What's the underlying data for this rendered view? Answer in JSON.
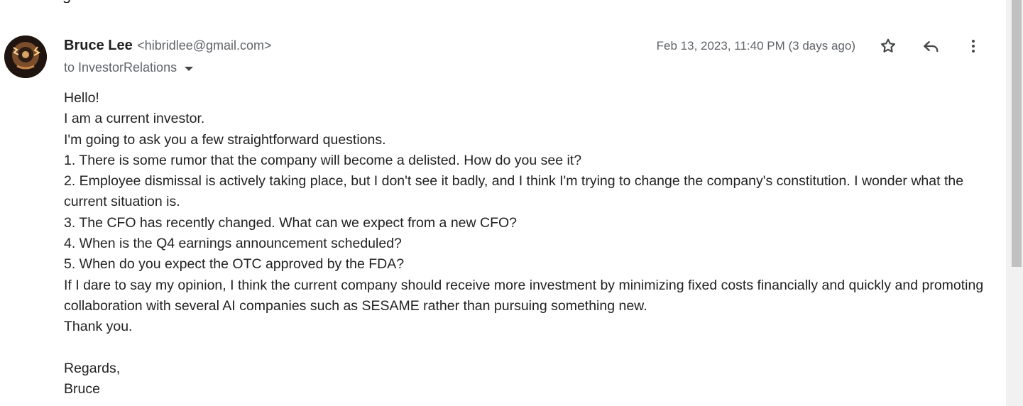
{
  "email": {
    "subject_remnant": "g",
    "sender": {
      "name": "Bruce Lee",
      "email": "<hibridlee@gmail.com>"
    },
    "recipient": "to InvestorRelations",
    "timestamp": "Feb 13, 2023, 11:40 PM (3 days ago)",
    "actions": {
      "star_icon": "star-icon",
      "reply_icon": "reply-icon",
      "more_icon": "more-vert-icon"
    },
    "body_lines": [
      "Hello!",
      "I am a current investor.",
      "I'm going to ask you a few straightforward questions.",
      "1. There is some rumor that the company will become a delisted. How do you see it?",
      "2. Employee dismissal is actively taking place, but I don't see it badly, and I think I'm trying to change the company's constitution. I wonder what the current situation is.",
      "3. The CFO has recently changed. What can we expect from a new CFO?",
      "4. When is the Q4 earnings announcement scheduled?",
      "5. When do you expect the OTC approved by the FDA?",
      "If I dare to say my opinion, I think the current company should receive more investment by minimizing fixed costs financially and quickly and promoting collaboration with several AI companies such as SESAME rather than pursuing something new.",
      "Thank you."
    ],
    "signature": {
      "closing": "Regards,",
      "name": "Bruce"
    }
  }
}
